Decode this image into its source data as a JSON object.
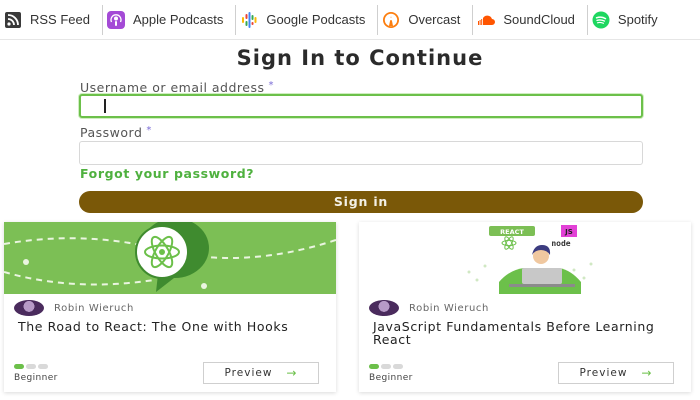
{
  "podcast_bar": {
    "items": [
      {
        "label": "RSS Feed",
        "icon": "rss-icon"
      },
      {
        "label": "Apple Podcasts",
        "icon": "apple-podcasts-icon"
      },
      {
        "label": "Google Podcasts",
        "icon": "google-podcasts-icon"
      },
      {
        "label": "Overcast",
        "icon": "overcast-icon"
      },
      {
        "label": "SoundCloud",
        "icon": "soundcloud-icon"
      },
      {
        "label": "Spotify",
        "icon": "spotify-icon"
      }
    ]
  },
  "signin": {
    "title": "Sign In to Continue",
    "username_label": "Username or email address",
    "username_value": "",
    "password_label": "Password",
    "password_value": "",
    "required_mark": "*",
    "forgot_link": "Forgot your password?",
    "submit_label": "Sign in"
  },
  "courses": [
    {
      "author": "Robin Wieruch",
      "title": "The Road to React: The One with Hooks",
      "level": "Beginner",
      "level_of": [
        1,
        3
      ],
      "preview_label": "Preview"
    },
    {
      "author": "Robin Wieruch",
      "title": "JavaScript Fundamentals Before Learning React",
      "level": "Beginner",
      "level_of": [
        1,
        3
      ],
      "preview_label": "Preview",
      "badges": [
        "REACT",
        "JS",
        "node"
      ]
    }
  ],
  "colors": {
    "accent_green": "#6cc04a",
    "signin_button": "#7a5808",
    "card_green": "#7cbf55"
  }
}
